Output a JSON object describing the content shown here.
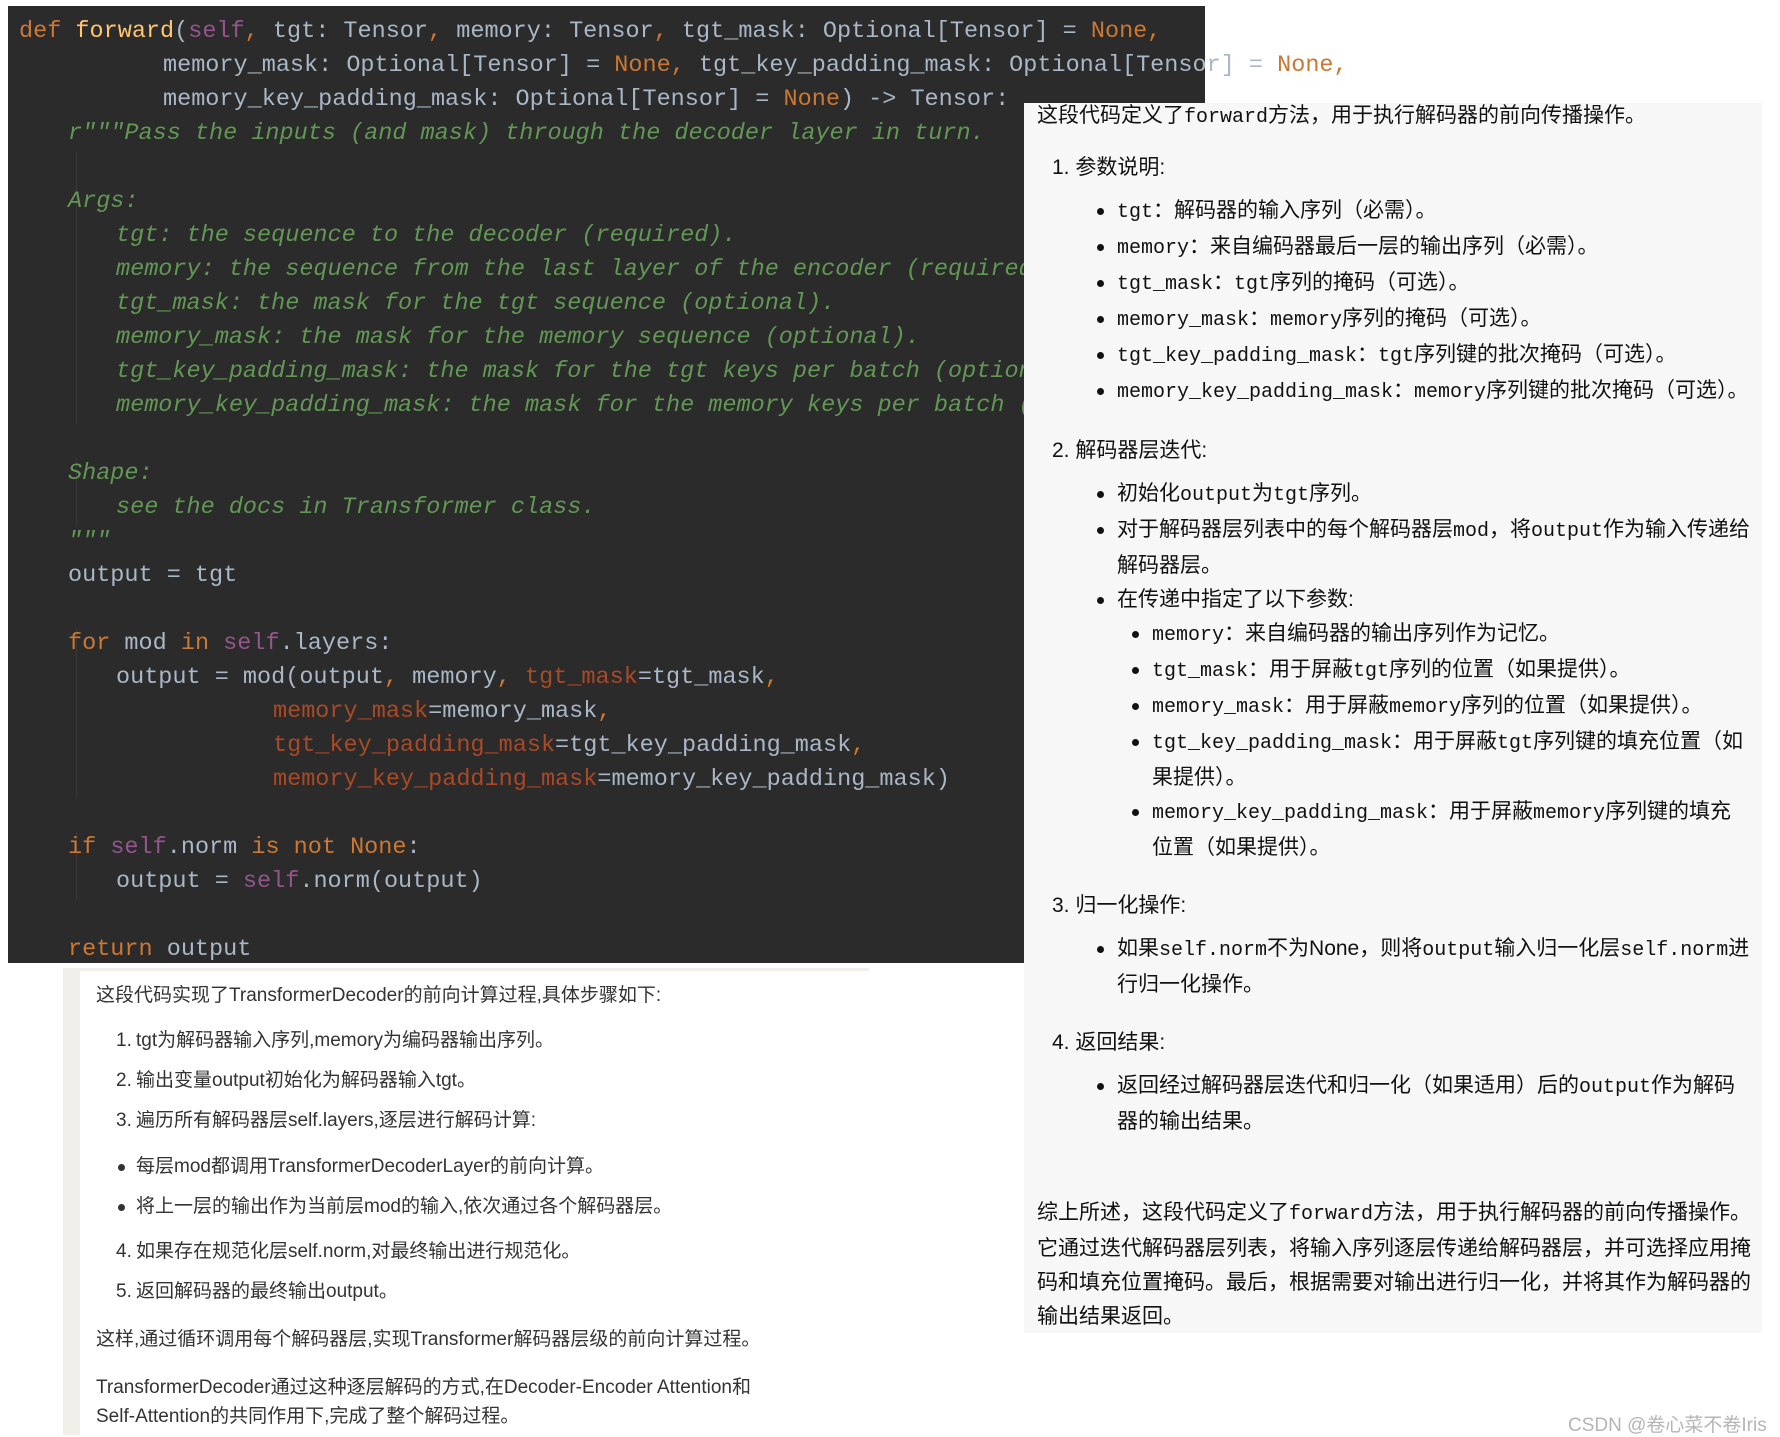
{
  "code_lines": [
    [
      [
        "kw",
        "def "
      ],
      [
        "fn",
        "forward"
      ],
      [
        "p",
        "("
      ],
      [
        "self",
        "self"
      ],
      [
        "kw",
        ", "
      ],
      [
        "p",
        "tgt: Tensor"
      ],
      [
        "kw",
        ", "
      ],
      [
        "p",
        "memory: Tensor"
      ],
      [
        "kw",
        ", "
      ],
      [
        "p",
        "tgt_mask: Optional[Tensor] = "
      ],
      [
        "kw",
        "None,"
      ]
    ],
    [
      [
        "p",
        "memory_mask: Optional[Tensor] = "
      ],
      [
        "kw",
        "None, "
      ],
      [
        "p",
        "tgt_key_padding_mask: Optional[Tensor] = "
      ],
      [
        "kw",
        "None,"
      ]
    ],
    [
      [
        "p",
        "memory_key_padding_mask: Optional[Tensor] = "
      ],
      [
        "kw",
        "None"
      ],
      [
        "p",
        ") -> Tensor:"
      ]
    ],
    [
      [
        "doc",
        "r\"\"\"Pass the inputs (and mask) through the decoder layer in turn."
      ]
    ],
    [],
    [
      [
        "doc",
        "Args:"
      ]
    ],
    [
      [
        "doc",
        "tgt: the sequence to the decoder (required)."
      ]
    ],
    [
      [
        "doc",
        "memory: the sequence from the last layer of the encoder (required)."
      ]
    ],
    [
      [
        "doc",
        "tgt_mask: the mask for the tgt sequence (optional)."
      ]
    ],
    [
      [
        "doc",
        "memory_mask: the mask for the memory sequence (optional)."
      ]
    ],
    [
      [
        "doc",
        "tgt_key_padding_mask: the mask for the tgt keys per batch (optional)."
      ]
    ],
    [
      [
        "doc",
        "memory_key_padding_mask: the mask for the memory keys per batch (optional)."
      ]
    ],
    [],
    [
      [
        "doc",
        "Shape:"
      ]
    ],
    [
      [
        "doc",
        "see the docs in Transformer class."
      ]
    ],
    [
      [
        "doc",
        "\"\"\""
      ]
    ],
    [
      [
        "p",
        "output = tgt"
      ]
    ],
    [],
    [
      [
        "kw",
        "for "
      ],
      [
        "p",
        "mod "
      ],
      [
        "kw",
        "in "
      ],
      [
        "self",
        "self"
      ],
      [
        "p",
        ".layers:"
      ]
    ],
    [
      [
        "p",
        "output = mod(output"
      ],
      [
        "kw",
        ", "
      ],
      [
        "p",
        "memory"
      ],
      [
        "kw",
        ", "
      ],
      [
        "arg",
        "tgt_mask"
      ],
      [
        "p",
        "=tgt_mask"
      ],
      [
        "kw",
        ","
      ]
    ],
    [
      [
        "arg",
        "memory_mask"
      ],
      [
        "p",
        "=memory_mask"
      ],
      [
        "kw",
        ","
      ]
    ],
    [
      [
        "arg",
        "tgt_key_padding_mask"
      ],
      [
        "p",
        "=tgt_key_padding_mask"
      ],
      [
        "kw",
        ","
      ]
    ],
    [
      [
        "arg",
        "memory_key_padding_mask"
      ],
      [
        "p",
        "=memory_key_padding_mask)"
      ]
    ],
    [],
    [
      [
        "kw",
        "if "
      ],
      [
        "self",
        "self"
      ],
      [
        "p",
        ".norm "
      ],
      [
        "kw",
        "is not None"
      ],
      [
        "p",
        ":"
      ]
    ],
    [
      [
        "p",
        "output = "
      ],
      [
        "self",
        "self"
      ],
      [
        "p",
        ".norm(output)"
      ]
    ],
    [],
    [
      [
        "kw",
        "return "
      ],
      [
        "p",
        "output"
      ]
    ]
  ],
  "right_panel": {
    "title": [
      [
        "t",
        "这段代码定义了"
      ],
      [
        "m",
        "forward"
      ],
      [
        "t",
        "方法，用于执行解码器的前向传播操作。"
      ]
    ],
    "sections": [
      {
        "heading": "1. 参数说明:",
        "items": [
          {
            "parts": [
              [
                "m",
                "tgt"
              ],
              [
                "t",
                "：解码器的输入序列（必需）。"
              ]
            ]
          },
          {
            "parts": [
              [
                "m",
                "memory"
              ],
              [
                "t",
                "：来自编码器最后一层的输出序列（必需）。"
              ]
            ]
          },
          {
            "parts": [
              [
                "m",
                "tgt_mask"
              ],
              [
                "t",
                "："
              ],
              [
                "m",
                "tgt"
              ],
              [
                "t",
                "序列的掩码（可选）。"
              ]
            ]
          },
          {
            "parts": [
              [
                "m",
                "memory_mask"
              ],
              [
                "t",
                "："
              ],
              [
                "m",
                "memory"
              ],
              [
                "t",
                "序列的掩码（可选）。"
              ]
            ]
          },
          {
            "parts": [
              [
                "m",
                "tgt_key_padding_mask"
              ],
              [
                "t",
                "："
              ],
              [
                "m",
                "tgt"
              ],
              [
                "t",
                "序列键的批次掩码（可选）。"
              ]
            ]
          },
          {
            "parts": [
              [
                "m",
                "memory_key_padding_mask"
              ],
              [
                "t",
                "："
              ],
              [
                "m",
                "memory"
              ],
              [
                "t",
                "序列键的批次掩码（可选）。"
              ]
            ]
          }
        ]
      },
      {
        "heading": "2. 解码器层迭代:",
        "items": [
          {
            "parts": [
              [
                "t",
                "初始化"
              ],
              [
                "m",
                "output"
              ],
              [
                "t",
                "为"
              ],
              [
                "m",
                "tgt"
              ],
              [
                "t",
                "序列。"
              ]
            ]
          },
          {
            "parts": [
              [
                "t",
                "对于解码器层列表中的每个解码器层"
              ],
              [
                "m",
                "mod"
              ],
              [
                "t",
                "，将"
              ],
              [
                "m",
                "output"
              ],
              [
                "t",
                "作为输入传递给解码器层。"
              ]
            ]
          },
          {
            "parts": [
              [
                "t",
                "在传递中指定了以下参数:"
              ]
            ],
            "sub": [
              {
                "parts": [
                  [
                    "m",
                    "memory"
                  ],
                  [
                    "t",
                    "：来自编码器的输出序列作为记忆。"
                  ]
                ]
              },
              {
                "parts": [
                  [
                    "m",
                    "tgt_mask"
                  ],
                  [
                    "t",
                    "：用于屏蔽"
                  ],
                  [
                    "m",
                    "tgt"
                  ],
                  [
                    "t",
                    "序列的位置（如果提供）。"
                  ]
                ]
              },
              {
                "parts": [
                  [
                    "m",
                    "memory_mask"
                  ],
                  [
                    "t",
                    "：用于屏蔽"
                  ],
                  [
                    "m",
                    "memory"
                  ],
                  [
                    "t",
                    "序列的位置（如果提供）。"
                  ]
                ]
              },
              {
                "parts": [
                  [
                    "m",
                    "tgt_key_padding_mask"
                  ],
                  [
                    "t",
                    "：用于屏蔽"
                  ],
                  [
                    "m",
                    "tgt"
                  ],
                  [
                    "t",
                    "序列键的填充位置（如果提供）。"
                  ]
                ]
              },
              {
                "parts": [
                  [
                    "m",
                    "memory_key_padding_mask"
                  ],
                  [
                    "t",
                    "：用于屏蔽"
                  ],
                  [
                    "m",
                    "memory"
                  ],
                  [
                    "t",
                    "序列键的填充位置（如果提供）。"
                  ]
                ]
              }
            ]
          }
        ]
      },
      {
        "heading": "3. 归一化操作:",
        "items": [
          {
            "parts": [
              [
                "t",
                "如果"
              ],
              [
                "m",
                "self.norm"
              ],
              [
                "t",
                "不为None，则将"
              ],
              [
                "m",
                "output"
              ],
              [
                "t",
                "输入归一化层"
              ],
              [
                "m",
                "self.norm"
              ],
              [
                "t",
                "进行归一化操作。"
              ]
            ]
          }
        ]
      },
      {
        "heading": "4. 返回结果:",
        "items": [
          {
            "parts": [
              [
                "t",
                "返回经过解码器层迭代和归一化（如果适用）后的"
              ],
              [
                "m",
                "output"
              ],
              [
                "t",
                "作为解码器的输出结果。"
              ]
            ]
          }
        ]
      }
    ],
    "summary": [
      [
        "t",
        "综上所述，这段代码定义了"
      ],
      [
        "m",
        "forward"
      ],
      [
        "t",
        "方法，用于执行解码器的前向传播操作。它通过迭代解码器层列表，将输入序列逐层传递给解码器层，并可选择应用掩码和填充位置掩码。最后，根据需要对输出进行归一化，并将其作为解码器的输出结果返回。"
      ]
    ]
  },
  "bottom_left": {
    "intro": "这段代码实现了TransformerDecoder的前向计算过程,具体步骤如下:",
    "steps_a": [
      {
        "num": "1.",
        "text": "tgt为解码器输入序列,memory为编码器输出序列。"
      },
      {
        "num": "2.",
        "text": "输出变量output初始化为解码器输入tgt。"
      },
      {
        "num": "3.",
        "text": "遍历所有解码器层self.layers,逐层进行解码计算:"
      }
    ],
    "bullets": [
      "每层mod都调用TransformerDecoderLayer的前向计算。",
      "将上一层的输出作为当前层mod的输入,依次通过各个解码器层。"
    ],
    "steps_b": [
      {
        "num": "4.",
        "text": "如果存在规范化层self.norm,对最终输出进行规范化。"
      },
      {
        "num": "5.",
        "text": "返回解码器的最终输出output。"
      }
    ],
    "para1": "这样,通过循环调用每个解码器层,实现Transformer解码器层级的前向计算过程。",
    "para2": "TransformerDecoder通过这种逐层解码的方式,在Decoder-Encoder Attention和Self-Attention的共同作用下,完成了整个解码过程。"
  },
  "watermark": "CSDN @卷心菜不卷Iris",
  "colors": {
    "code_bg": "#2b2b2b",
    "keyword": "#cc7832",
    "text": "#a9b7c6",
    "docstring": "#629755",
    "self": "#94558d",
    "function": "#ffc66d",
    "named_arg": "#aa4926",
    "panel_bg": "#f7f7f7"
  }
}
